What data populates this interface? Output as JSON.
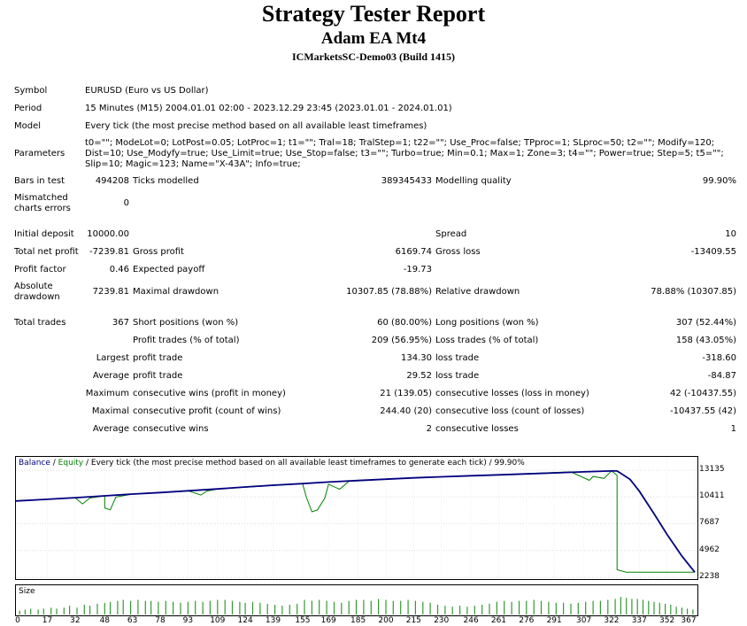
{
  "header": {
    "title": "Strategy Tester Report",
    "ea_name": "Adam EA Mt4",
    "server": "ICMarketsSC-Demo03 (Build 1415)"
  },
  "info": {
    "symbol_label": "Symbol",
    "symbol": "EURUSD (Euro vs US Dollar)",
    "period_label": "Period",
    "period": "15 Minutes (M15) 2004.01.01 02:00 - 2023.12.29 23:45 (2023.01.01 - 2024.01.01)",
    "model_label": "Model",
    "model": "Every tick (the most precise method based on all available least timeframes)",
    "parameters_label": "Parameters",
    "parameters": "t0=\"\"; ModeLot=0; LotPost=0.05; LotProc=1; t1=\"\"; Tral=18; TralStep=1; t22=\"\"; Use_Proc=false; TPproc=1; SLproc=50; t2=\"\"; Modify=120; Dist=10; Use_Modyfy=true; Use_Limit=true; Use_Stop=false; t3=\"\"; Turbo=true; Min=0.1; Max=1; Zone=3; t4=\"\"; Power=true; Step=5; t5=\"\"; Slip=10; Magic=123; Name=\"X-43A\"; Info=true;"
  },
  "stats": {
    "bars_label": "Bars in test",
    "bars": "494208",
    "ticks_label": "Ticks modelled",
    "ticks": "389345433",
    "quality_label": "Modelling quality",
    "quality": "99.90%",
    "mismatch_label": "Mismatched charts errors",
    "mismatch": "0",
    "deposit_label": "Initial deposit",
    "deposit": "10000.00",
    "spread_label": "Spread",
    "spread": "10",
    "net_label": "Total net profit",
    "net": "-7239.81",
    "gross_profit_label": "Gross profit",
    "gross_profit": "6169.74",
    "gross_loss_label": "Gross loss",
    "gross_loss": "-13409.55",
    "pf_label": "Profit factor",
    "pf": "0.46",
    "ep_label": "Expected payoff",
    "ep": "-19.73",
    "abs_dd_label": "Absolute drawdown",
    "abs_dd": "7239.81",
    "max_dd_label": "Maximal drawdown",
    "max_dd": "10307.85 (78.88%)",
    "rel_dd_label": "Relative drawdown",
    "rel_dd": "78.88% (10307.85)",
    "trades_label": "Total trades",
    "trades": "367",
    "short_label": "Short positions (won %)",
    "short": "60 (80.00%)",
    "long_label": "Long positions (won %)",
    "long": "307 (52.44%)",
    "pt_label": "Profit trades (% of total)",
    "pt": "209 (56.95%)",
    "lt_label": "Loss trades (% of total)",
    "lt": "158 (43.05%)",
    "largest_label": "Largest",
    "largest_profit_label": "profit trade",
    "largest_profit": "134.30",
    "largest_loss_label": "loss trade",
    "largest_loss": "-318.60",
    "average_label": "Average",
    "avg_profit_label": "profit trade",
    "avg_profit": "29.52",
    "avg_loss_label": "loss trade",
    "avg_loss": "-84.87",
    "maximum_label": "Maximum",
    "max_cw_label": "consecutive wins (profit in money)",
    "max_cw": "21 (139.05)",
    "max_cl_label": "consecutive losses (loss in money)",
    "max_cl": "42 (-10437.55)",
    "maximal_label": "Maximal",
    "mx_cp_label": "consecutive profit (count of wins)",
    "mx_cp": "244.40 (20)",
    "mx_cl_label": "consecutive loss (count of losses)",
    "mx_cl": "-10437.55 (42)",
    "average2_label": "Average",
    "avg_cw_label": "consecutive wins",
    "avg_cw": "2",
    "avg_cl_label": "consecutive losses",
    "avg_cl": "1"
  },
  "chart_legend": {
    "balance": "Balance",
    "sep": " / ",
    "equity": "Equity",
    "rest": " / Every tick (the most precise method based on all available least timeframes to generate each tick) / 99.90%"
  },
  "size_label": "Size",
  "colors": {
    "balance": "#00007f",
    "equity": "#008000",
    "size_bar": "#339933"
  },
  "chart_data": {
    "type": "line",
    "xlim": [
      0,
      367
    ],
    "ylim": [
      2238,
      13135
    ],
    "yticks": [
      "13135",
      "10411",
      "7687",
      "4962",
      "2238"
    ],
    "xticks": [
      "0",
      "17",
      "32",
      "48",
      "63",
      "78",
      "93",
      "109",
      "124",
      "139",
      "155",
      "169",
      "185",
      "200",
      "215",
      "230",
      "246",
      "261",
      "276",
      "291",
      "307",
      "322",
      "337",
      "352",
      "367"
    ],
    "series": [
      {
        "name": "Balance",
        "x": [
          0,
          17,
          32,
          48,
          63,
          78,
          93,
          109,
          124,
          139,
          155,
          169,
          185,
          200,
          215,
          230,
          246,
          261,
          276,
          291,
          307,
          322,
          325,
          332,
          337,
          345,
          352,
          360,
          367
        ],
        "y": [
          10000,
          10170,
          10330,
          10520,
          10700,
          10860,
          11040,
          11230,
          11420,
          11600,
          11770,
          11930,
          12080,
          12220,
          12350,
          12460,
          12570,
          12660,
          12760,
          12860,
          12960,
          13050,
          13050,
          12200,
          11000,
          8700,
          6600,
          4400,
          2760
        ]
      },
      {
        "name": "Equity",
        "x": [
          0,
          17,
          32,
          36,
          40,
          48,
          48,
          51,
          54,
          63,
          93,
          100,
          103,
          109,
          155,
          157,
          160,
          163,
          167,
          169,
          175,
          180,
          190,
          200,
          230,
          260,
          300,
          310,
          312,
          318,
          320,
          322,
          325,
          325,
          330,
          337,
          367
        ],
        "y": [
          10000,
          10170,
          10330,
          9700,
          10300,
          10520,
          9300,
          9100,
          10400,
          10700,
          11040,
          10600,
          11000,
          11230,
          11770,
          10400,
          8900,
          9100,
          10300,
          11700,
          11200,
          12000,
          12100,
          12220,
          12460,
          12660,
          12960,
          12100,
          12500,
          12300,
          12700,
          13050,
          12600,
          3000,
          2760,
          2760,
          2760
        ]
      }
    ],
    "size": {
      "x": [
        2,
        5,
        8,
        12,
        15,
        19,
        22,
        26,
        29,
        33,
        37,
        40,
        44,
        48,
        51,
        55,
        58,
        62,
        66,
        70,
        73,
        77,
        81,
        85,
        89,
        93,
        97,
        101,
        105,
        109,
        113,
        117,
        121,
        124,
        128,
        132,
        136,
        140,
        144,
        148,
        152,
        156,
        160,
        164,
        168,
        172,
        176,
        180,
        184,
        188,
        192,
        196,
        200,
        204,
        208,
        212,
        216,
        220,
        224,
        228,
        232,
        236,
        240,
        244,
        248,
        252,
        256,
        260,
        264,
        268,
        272,
        276,
        280,
        284,
        288,
        292,
        296,
        300,
        304,
        308,
        312,
        316,
        320,
        324,
        327,
        330,
        333,
        336,
        339,
        342,
        345,
        348,
        351,
        354,
        357,
        360,
        363,
        366
      ],
      "values": [
        0.2,
        0.25,
        0.3,
        0.25,
        0.3,
        0.35,
        0.3,
        0.35,
        0.45,
        0.35,
        0.5,
        0.45,
        0.55,
        0.6,
        0.65,
        0.7,
        0.75,
        0.7,
        0.75,
        0.7,
        0.7,
        0.65,
        0.7,
        0.65,
        0.6,
        0.65,
        0.7,
        0.65,
        0.7,
        0.75,
        0.75,
        0.7,
        0.65,
        0.6,
        0.65,
        0.6,
        0.55,
        0.5,
        0.45,
        0.5,
        0.55,
        0.75,
        0.7,
        0.75,
        0.7,
        0.65,
        0.6,
        0.7,
        0.75,
        0.75,
        0.7,
        0.8,
        0.75,
        0.7,
        0.7,
        0.75,
        0.7,
        0.65,
        0.6,
        0.5,
        0.45,
        0.4,
        0.45,
        0.4,
        0.45,
        0.5,
        0.55,
        0.65,
        0.7,
        0.65,
        0.7,
        0.7,
        0.75,
        0.7,
        0.65,
        0.6,
        0.6,
        0.55,
        0.6,
        0.65,
        0.7,
        0.7,
        0.75,
        0.8,
        0.9,
        0.85,
        0.8,
        0.8,
        0.75,
        0.7,
        0.65,
        0.6,
        0.55,
        0.5,
        0.4,
        0.35,
        0.3,
        0.25
      ]
    }
  }
}
